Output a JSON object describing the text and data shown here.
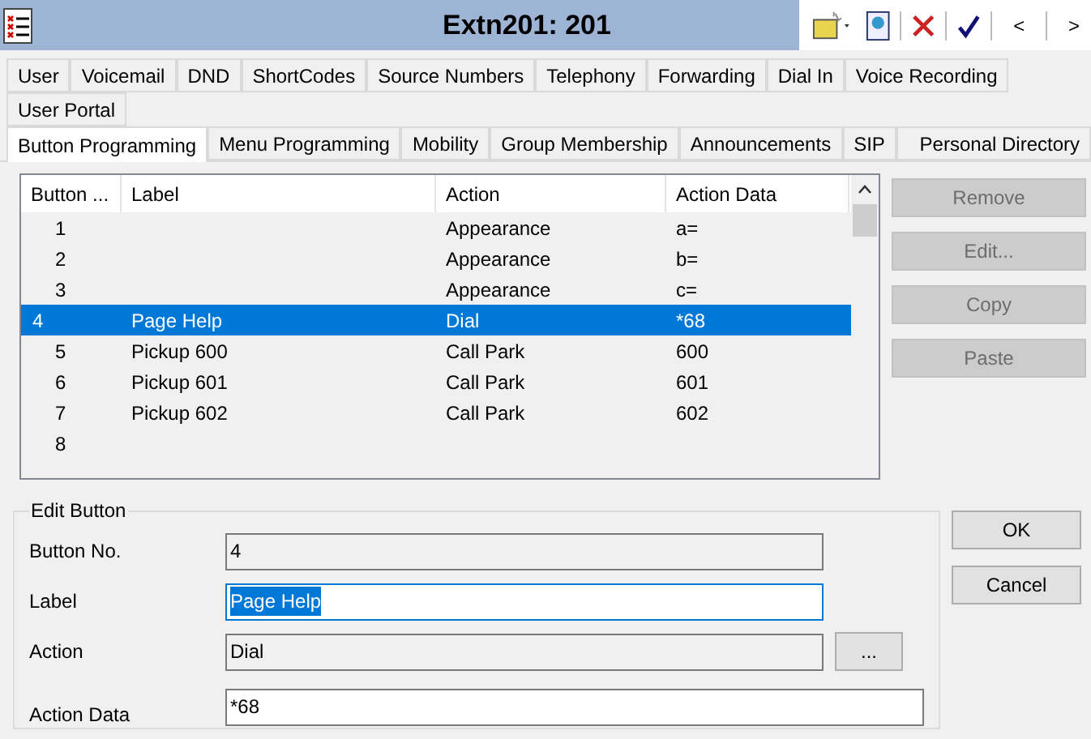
{
  "window": {
    "title": "Extn201: 201"
  },
  "toolbar": {
    "prev": "<",
    "next": ">"
  },
  "tab_rows": [
    [
      {
        "label": "User",
        "selected": false
      },
      {
        "label": "Voicemail",
        "selected": false
      },
      {
        "label": "DND",
        "selected": false
      },
      {
        "label": "ShortCodes",
        "selected": false
      },
      {
        "label": "Source Numbers",
        "selected": false
      },
      {
        "label": "Telephony",
        "selected": false
      },
      {
        "label": "Forwarding",
        "selected": false
      },
      {
        "label": "Dial In",
        "selected": false
      },
      {
        "label": "Voice Recording",
        "selected": false
      }
    ],
    [
      {
        "label": "User Portal",
        "selected": false
      }
    ],
    [
      {
        "label": "Button Programming",
        "selected": true
      },
      {
        "label": "Menu Programming",
        "selected": false
      },
      {
        "label": "Mobility",
        "selected": false
      },
      {
        "label": "Group Membership",
        "selected": false
      },
      {
        "label": "Announcements",
        "selected": false
      },
      {
        "label": "SIP",
        "selected": false
      },
      {
        "label": "Personal Directory",
        "selected": false
      }
    ]
  ],
  "table": {
    "columns": [
      "Button ...",
      "Label",
      "Action",
      "Action Data"
    ],
    "rows": [
      {
        "cells": [
          "1",
          "",
          "Appearance",
          "a="
        ],
        "selected": false
      },
      {
        "cells": [
          "2",
          "",
          "Appearance",
          "b="
        ],
        "selected": false
      },
      {
        "cells": [
          "3",
          "",
          "Appearance",
          "c="
        ],
        "selected": false
      },
      {
        "cells": [
          "4",
          "Page Help",
          "Dial",
          "*68"
        ],
        "selected": true
      },
      {
        "cells": [
          "5",
          "Pickup 600",
          "Call Park",
          "600"
        ],
        "selected": false
      },
      {
        "cells": [
          "6",
          "Pickup 601",
          "Call Park",
          "601"
        ],
        "selected": false
      },
      {
        "cells": [
          "7",
          "Pickup 602",
          "Call Park",
          "602"
        ],
        "selected": false
      },
      {
        "cells": [
          "8",
          "",
          "",
          ""
        ],
        "selected": false
      }
    ]
  },
  "side_buttons": [
    {
      "label": "Remove",
      "disabled": true
    },
    {
      "label": "Edit...",
      "disabled": true
    },
    {
      "label": "Copy",
      "disabled": true
    },
    {
      "label": "Paste",
      "disabled": true
    }
  ],
  "edit_group": {
    "title": "Edit Button",
    "fields": [
      {
        "label": "Button No.",
        "value": "4",
        "readonly": true,
        "highlighted": false
      },
      {
        "label": "Label",
        "value": "Page Help",
        "readonly": false,
        "highlighted": true
      },
      {
        "label": "Action",
        "value": "Dial",
        "readonly": true,
        "highlighted": false,
        "browse": "..."
      },
      {
        "label": "Action Data",
        "value": "*68",
        "readonly": false,
        "highlighted": false
      }
    ]
  },
  "dialog_buttons": [
    "OK",
    "Cancel"
  ]
}
